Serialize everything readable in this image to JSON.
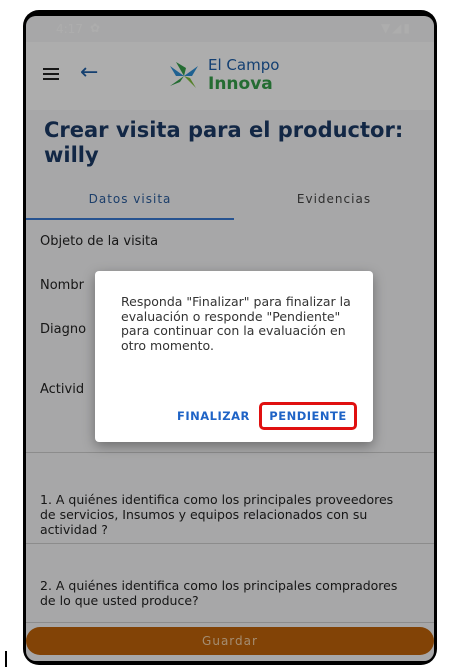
{
  "status": {
    "time": "4:17",
    "settings_icon": "gear-icon",
    "signal_icons": "wifi-icon, signal-icon, battery-icon"
  },
  "appbar": {
    "menu_icon": "menu-icon",
    "back_icon": "arrow-left-icon",
    "logo_line1": "El Campo",
    "logo_line2": "Innova"
  },
  "page": {
    "title": "Crear visita para el productor: willy"
  },
  "tabs": [
    {
      "label": "Datos visita",
      "active": true
    },
    {
      "label": "Evidencias",
      "active": false
    }
  ],
  "fields": [
    {
      "label": "Objeto de la visita"
    },
    {
      "label": "Nombr"
    },
    {
      "label": "Diagno"
    },
    {
      "label": "Activid"
    }
  ],
  "questions": [
    {
      "text": "1. A quiénes identifica como los principales proveedores de servicios, Insumos y equipos relacionados con su actividad ?"
    },
    {
      "text": "2. A quiénes identifica como los principales compradores de lo que usted produce?"
    }
  ],
  "dialog": {
    "message": "Responda \"Finalizar\" para finalizar la evaluación o responde \"Pendiente\" para continuar con la evaluación en otro momento.",
    "finalize_label": "FINALIZAR",
    "pending_label": "PENDIENTE"
  },
  "footer": {
    "save_label": "Guardar"
  },
  "colors": {
    "brand_blue": "#1b3a66",
    "accent_orange": "#c0640a",
    "highlight_red": "#e01010"
  }
}
